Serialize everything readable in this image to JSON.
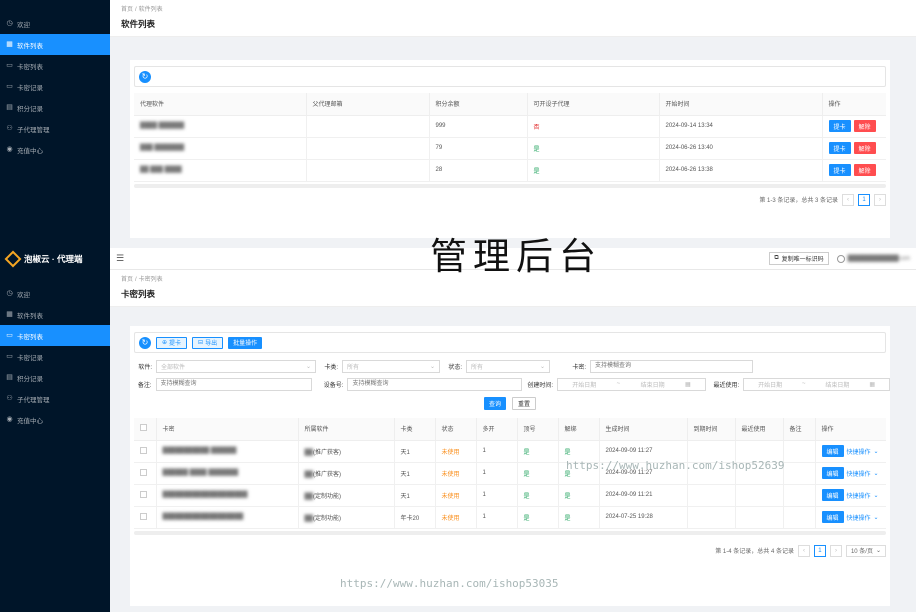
{
  "sidebar_top": {
    "items": [
      {
        "icon": "clock-icon",
        "label": "欢迎",
        "active": false
      },
      {
        "icon": "grid-icon",
        "label": "软件列表",
        "active": true
      },
      {
        "icon": "card-icon",
        "label": "卡密列表",
        "active": false
      },
      {
        "icon": "card-icon",
        "label": "卡密记录",
        "active": false
      },
      {
        "icon": "list-icon",
        "label": "积分记录",
        "active": false
      },
      {
        "icon": "user-group-icon",
        "label": "子代理管理",
        "active": false
      },
      {
        "icon": "recharge-icon",
        "label": "充值中心",
        "active": false
      }
    ]
  },
  "top_panel": {
    "breadcrumb": {
      "home": "首页",
      "sep": "/",
      "current": "软件列表"
    },
    "title": "软件列表",
    "table": {
      "headers": [
        "代理软件",
        "父代理邮箱",
        "积分余额",
        "可开设子代理",
        "开始时间",
        "操作"
      ],
      "rows": [
        {
          "software": "████ ██████",
          "parent_email": "",
          "balance": "999",
          "can_sub": "否",
          "can_sub_status": "no",
          "start": "2024-09-14 13:34"
        },
        {
          "software": "███ ███████",
          "parent_email": "",
          "balance": "79",
          "can_sub": "是",
          "can_sub_status": "yes",
          "start": "2024-06-26 13:40"
        },
        {
          "software": "██ ███ ████",
          "parent_email": "",
          "balance": "28",
          "can_sub": "是",
          "can_sub_status": "yes",
          "start": "2024-06-26 13:38"
        }
      ],
      "action_primary": "提卡",
      "action_danger": "解除"
    },
    "pager": {
      "summary": "第 1-3 条记录，总共 3 条记录",
      "page": "1",
      "prev": "‹",
      "next": "›"
    }
  },
  "overlay": {
    "title": "管理后台"
  },
  "brand": {
    "name": "泡椒云 · 代理端"
  },
  "topbar": {
    "menu_icon": "☰",
    "copy_button": "复制唯一标识码",
    "user": "████████████com"
  },
  "sidebar_bottom": {
    "items": [
      {
        "icon": "clock-icon",
        "label": "欢迎",
        "active": false
      },
      {
        "icon": "grid-icon",
        "label": "软件列表",
        "active": false
      },
      {
        "icon": "card-icon",
        "label": "卡密列表",
        "active": true
      },
      {
        "icon": "card-icon",
        "label": "卡密记录",
        "active": false
      },
      {
        "icon": "list-icon",
        "label": "积分记录",
        "active": false
      },
      {
        "icon": "user-group-icon",
        "label": "子代理管理",
        "active": false
      },
      {
        "icon": "recharge-icon",
        "label": "充值中心",
        "active": false
      }
    ]
  },
  "bottom_panel": {
    "breadcrumb": {
      "home": "首页",
      "sep": "/",
      "current": "卡密列表"
    },
    "title": "卡密列表",
    "toolbar": {
      "extract": "提卡",
      "export": "导出",
      "batch": "批量操作"
    },
    "filters": {
      "software_label": "软件:",
      "software_placeholder": "全部软件",
      "type_label": "卡类:",
      "type_placeholder": "所有",
      "status_label": "状态:",
      "status_placeholder": "所有",
      "card_label": "卡密:",
      "card_placeholder": "支持模糊查询",
      "note_label": "备注:",
      "note_placeholder": "支持模糊查询",
      "device_label": "设备号:",
      "device_placeholder": "支持模糊查询",
      "created_label": "创建时间:",
      "start_placeholder": "开始日期",
      "end_placeholder": "结束日期",
      "last_used_label": "最近使用:",
      "range_sep": "~",
      "search_button": "查询",
      "reset_button": "重置"
    },
    "table": {
      "headers": [
        "卡密",
        "所属软件",
        "卡类",
        "状态",
        "多开",
        "顶号",
        "解绑",
        "生成时间",
        "到期时间",
        "最近使用",
        "备注",
        "操作"
      ],
      "rows": [
        {
          "card": "███████████ ██████",
          "software_prefix": "██",
          "software_tag": "(推广获客)",
          "type": "天1",
          "status": "未使用",
          "multi": "1",
          "top": "是",
          "unbind": "是",
          "created": "2024-09-09 11:27"
        },
        {
          "card": "██████ ████ ███████",
          "software_prefix": "██",
          "software_tag": "(推广获客)",
          "type": "天1",
          "status": "未使用",
          "multi": "1",
          "top": "是",
          "unbind": "是",
          "created": "2024-09-09 11:27"
        },
        {
          "card": "████████████████████",
          "software_prefix": "██",
          "software_tag": "(定制功能)",
          "type": "天1",
          "status": "未使用",
          "multi": "1",
          "top": "是",
          "unbind": "是",
          "created": "2024-09-09 11:21"
        },
        {
          "card": "███████████████████",
          "software_prefix": "██",
          "software_tag": "(定制功能)",
          "type": "年卡20",
          "status": "未使用",
          "multi": "1",
          "top": "是",
          "unbind": "是",
          "created": "2024-07-25 19:28"
        }
      ],
      "edit": "编辑",
      "quick": "快捷操作"
    },
    "pager": {
      "summary": "第 1-4 条记录，总共 4 条记录",
      "page": "1",
      "prev": "‹",
      "next": "›",
      "size": "10 条/页"
    }
  },
  "watermarks": {
    "one": "https://www.huzhan.com/ishop52639",
    "two": "https://www.huzhan.com/ishop53035"
  }
}
